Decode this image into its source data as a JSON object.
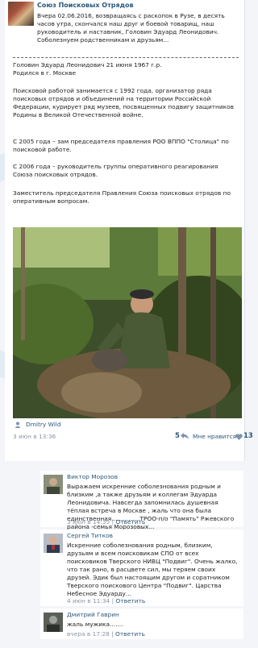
{
  "post": {
    "author": "Союз Поисковых Отрядов",
    "intro": "Вчера 02.06.2016, возвращаясь с раскопок в Рузе, в десять часов утра, скончался наш друг и боевой товарищ, наш руководитель и наставник, Головин Эдуард Леонидович. Соболезнуем родственникам и друзьям...",
    "bio_line1": "Головин Эдуард Леонидович 21 июня 1967 г.р.",
    "bio_line2": "Родился в г. Москве",
    "para1": "Поисковой работой занимается с 1992 года, организатор ряда поисковых отрядов и объединений на территории Российской Федерации, курирует ряд музеев, посвященных подвигу защитников Родины в Великой Отечественной войне.",
    "para2": "С 2005 года – зам председателя правления РОО ВППО \"Столица\" по поисковой работе.",
    "para3": "С 2006 года – руководитель группы оперативного реагирования Союза поисковых отрядов.",
    "para4": "Заместитель председателя Правления Союза поисковых отрядов по оперативным вопросам.",
    "tag_name": "Dmitry Wild",
    "date": "3 июн в 13:36",
    "reply_count": "5",
    "like_label": "Мне нравится",
    "like_count": "13"
  },
  "comments": [
    {
      "name": "Виктор Морозов",
      "text": "Выражаем искренние соболезнования родным и близким ,а также друзьям и коллегам Эдуарда Леонидовича. Навсегда запомнилась душевная тёплая встреча в Москве , жаль что она была единственная...............ТРОО-п/о \"Память\" Ржевского района -семья Морозовых...",
      "date": "3 июн в 14:35",
      "reply": "Ответить"
    },
    {
      "name": "Сергей Титков",
      "text": "Искренние соболезнования родным, близким, друзьям и всем поисковикам СПО от всех поисковиков Тверского НИВЦ \"Подвиг\". Очень жалко, что так рано, в расцвете сил, мы теряем своих друзей. Эдик был настоящим другом и соратником Тверского поискового Центра \"Подвиг\". Царства Небесное Эдуарду...",
      "date": "4 июн в 11:34",
      "reply": "Ответить"
    },
    {
      "name": "Дмитрий Гаврин",
      "text": "жаль мужика.......",
      "date": "вчера в 17:28",
      "reply": "Ответить"
    }
  ],
  "colors": {
    "link": "#2b587a",
    "meta": "#8a95a3"
  },
  "icons": [
    "tag-person-icon",
    "reply-arrow-icon",
    "heart-icon"
  ]
}
